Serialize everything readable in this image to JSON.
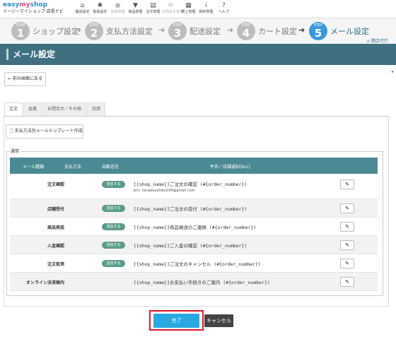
{
  "brand": {
    "logo_prefix": "easy",
    "logo_em": "my",
    "logo_suffix": "shop",
    "subtitle": "イージーマイショップ 店長ナビ"
  },
  "nav": [
    {
      "label": "開店設定",
      "icon": "home-icon",
      "glyph": "⌂"
    },
    {
      "label": "拡張設定",
      "icon": "gear-icon",
      "glyph": "✱"
    },
    {
      "label": "会員管理",
      "icon": "user-icon",
      "glyph": "●"
    },
    {
      "label": "商品管理",
      "icon": "shirt-icon",
      "glyph": "▼"
    },
    {
      "label": "注文管理",
      "icon": "document-icon",
      "glyph": "▤"
    },
    {
      "label": "お問合せ管理",
      "icon": "envelope-icon",
      "glyph": "✉"
    },
    {
      "label": "売上管理",
      "icon": "calculator-icon",
      "glyph": "▦"
    },
    {
      "label": "契約管理",
      "icon": "info-icon",
      "glyph": "i"
    },
    {
      "label": "ヘルプ",
      "icon": "help-icon",
      "glyph": "?"
    }
  ],
  "steps": [
    {
      "step_word": "STEP",
      "number": "1",
      "label": "ショップ設定"
    },
    {
      "step_word": "STEP",
      "number": "2",
      "label": "支払方法設定"
    },
    {
      "step_word": "STEP",
      "number": "3",
      "label": "配送設定"
    },
    {
      "step_word": "STEP",
      "number": "4",
      "label": "カート設定"
    },
    {
      "step_word": "STEP",
      "number": "5",
      "label": "メール設定"
    }
  ],
  "store_link": "開店代行",
  "page_title": "メール設定",
  "back_button": "前の画面に戻る",
  "tabs": [
    "注文",
    "会員",
    "お問合せ／その他",
    "汎用"
  ],
  "template_button": "支払方法別メールテンプレート作成",
  "group_label": "通常",
  "table": {
    "headers": [
      "メール種類",
      "支払方法",
      "自動送信",
      "件名／店舗通知(bcc)"
    ],
    "rows": [
      {
        "type": "注文確認",
        "payment": "-",
        "auto": "送信する",
        "subject": "[{shop_name}]ご注文の確認 (#{order_number})",
        "bcc": "bcc: tanabeyohiko234@gmail.com"
      },
      {
        "type": "店舗受付",
        "payment": "-",
        "auto": "送信する",
        "subject": "[{shop_name}]ご注文の受付 (#{order_number})",
        "bcc": ""
      },
      {
        "type": "商品発送",
        "payment": "-",
        "auto": "送信する",
        "subject": "[{shop_name}]商品発送のご連絡 (#{order_number})",
        "bcc": ""
      },
      {
        "type": "入金確認",
        "payment": "-",
        "auto": "送信する",
        "subject": "[{shop_name}]ご入金の確認 (#{order_number})",
        "bcc": ""
      },
      {
        "type": "注文取消",
        "payment": "-",
        "auto": "送信する",
        "subject": "[{shop_name}]ご注文のキャンセル (#{order_number})",
        "bcc": ""
      },
      {
        "type": "オンライン決済案内",
        "payment": "-",
        "auto": "",
        "subject": "[{shop_name}]お支払い手続きのご案内 (#{order_number})",
        "bcc": ""
      }
    ]
  },
  "buttons": {
    "done": "完了",
    "cancel": "キャンセル"
  },
  "colors": {
    "title_bar": "#3e7080",
    "table_header": "#4b8a95",
    "active_step": "#3a9ad9",
    "done": "#2aa8e0",
    "highlight": "#e0182a"
  }
}
